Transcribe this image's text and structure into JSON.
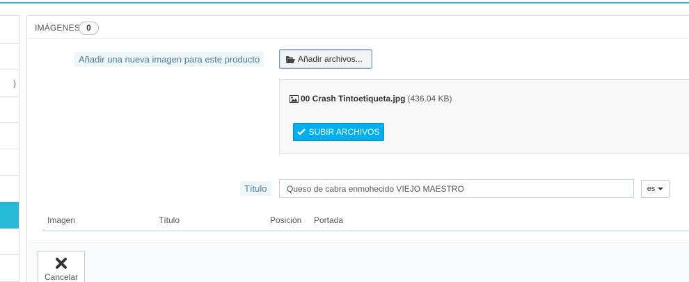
{
  "panel": {
    "title": "IMÁGENES",
    "count": "0"
  },
  "sidebar": {
    "partial_text": ")"
  },
  "upload": {
    "add_label": "Añadir una nueva imagen para este producto",
    "add_button": "Añadir archivos...",
    "file_name": "00 Crash Tintoetiqueta.jpg",
    "file_size": "(436.04 KB)",
    "upload_button": "SUBIR ARCHIVOS"
  },
  "title_field": {
    "label": "Título",
    "value": "Queso de cabra enmohecido VIEJO MAESTRO",
    "language": "es"
  },
  "table": {
    "columns": [
      "Imagen",
      "Título",
      "Posición",
      "Portada"
    ]
  },
  "footer": {
    "cancel_label": "Cancelar"
  },
  "colors": {
    "accent": "#25b9d7",
    "primary_button": "#00aff0"
  },
  "icons": {
    "add": "folder-open-icon",
    "file": "image-icon",
    "upload": "check-icon",
    "cancel": "close-icon"
  }
}
